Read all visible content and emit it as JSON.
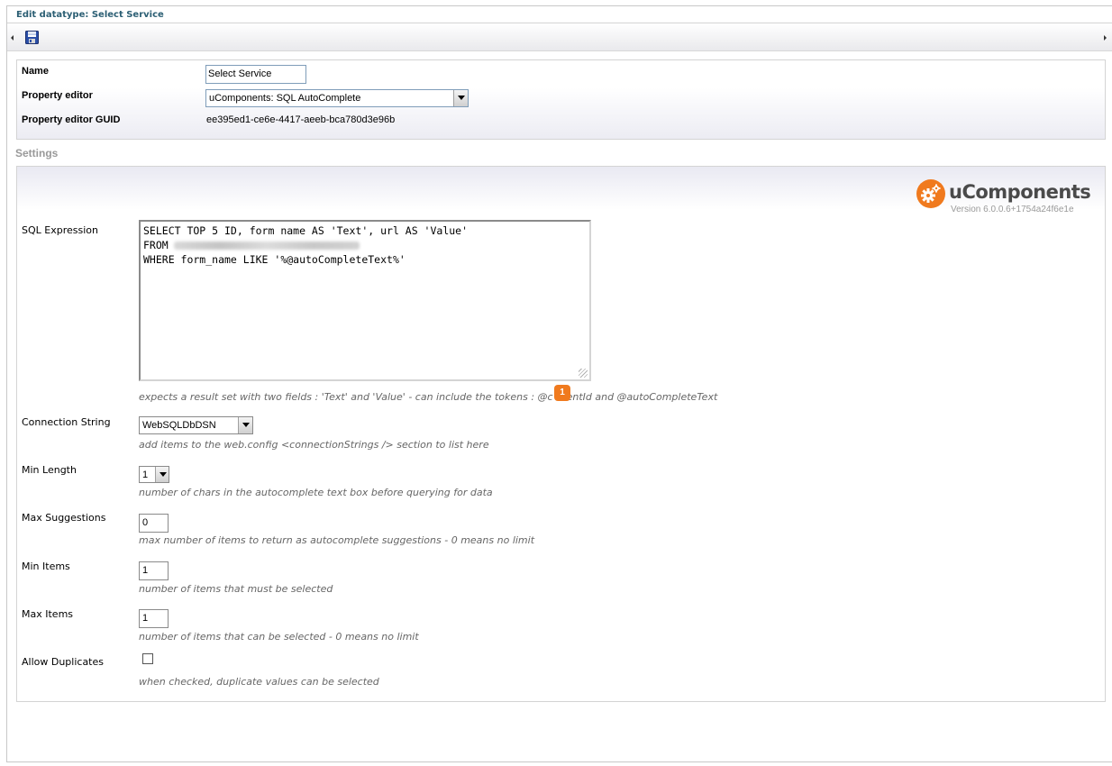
{
  "header": {
    "title": "Edit datatype: Select Service"
  },
  "toolbar": {
    "save_icon": "floppy-disk-icon"
  },
  "properties": {
    "name_label": "Name",
    "name_value": "Select Service",
    "editor_label": "Property editor",
    "editor_value": "uComponents: SQL AutoComplete",
    "guid_label": "Property editor GUID",
    "guid_value": "ee395ed1-ce6e-4417-aeeb-bca780d3e96b"
  },
  "settings": {
    "heading": "Settings",
    "logo": {
      "name": "uComponents",
      "version": "Version 6.0.0.6+1754a24f6e1e",
      "brand_color": "#f07a1e"
    },
    "sql": {
      "label": "SQL Expression",
      "line1": "SELECT TOP 5 ID, form name AS 'Text', url AS 'Value'",
      "line2": "FROM",
      "line3": "WHERE form_name LIKE '%@autoCompleteText%'",
      "hint_pre": "expects a result set with two fields : 'Text' and 'Value' - can include the tokens : @c",
      "hint_post": "entId and @autoCompleteText",
      "badge": "1"
    },
    "connection": {
      "label": "Connection String",
      "value": "WebSQLDbDSN",
      "hint": "add items to the web.config <connectionStrings /> section to list here"
    },
    "min_length": {
      "label": "Min Length",
      "value": "1",
      "hint": "number of chars in the autocomplete text box before querying for data"
    },
    "max_suggestions": {
      "label": "Max Suggestions",
      "value": "0",
      "hint": "max number of items to return as autocomplete suggestions - 0 means no limit"
    },
    "min_items": {
      "label": "Min Items",
      "value": "1",
      "hint": "number of items that must be selected"
    },
    "max_items": {
      "label": "Max Items",
      "value": "1",
      "hint": "number of items that can be selected - 0 means no limit"
    },
    "allow_duplicates": {
      "label": "Allow Duplicates",
      "checked": false,
      "hint": "when checked, duplicate values can be selected"
    }
  }
}
